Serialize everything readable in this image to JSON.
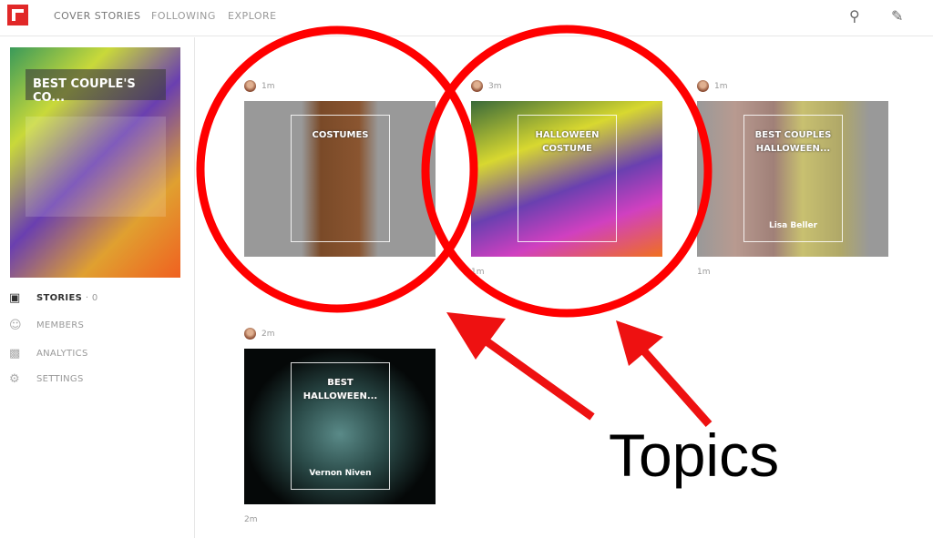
{
  "nav": {
    "items": [
      "COVER STORIES",
      "FOLLOWING",
      "EXPLORE"
    ]
  },
  "icons": {
    "logo": "flipboard-logo",
    "search": "search-icon",
    "edit": "pencil-icon"
  },
  "sidebar": {
    "cover_title": "BEST COUPLE'S CO...",
    "items": [
      {
        "label": "STORIES",
        "count": "· 0",
        "icon": "monitor-icon"
      },
      {
        "label": "MEMBERS",
        "icon": "add-user-icon"
      },
      {
        "label": "ANALYTICS",
        "icon": "bar-chart-icon"
      },
      {
        "label": "SETTINGS",
        "icon": "gear-icon"
      }
    ]
  },
  "cards": [
    {
      "time": "1m",
      "title": "COSTUMES",
      "author": "",
      "below": ""
    },
    {
      "time": "3m",
      "title": "HALLOWEEN COSTUME",
      "author": "",
      "below": "1m"
    },
    {
      "time": "1m",
      "title": "BEST COUPLES HALLOWEEN...",
      "author": "Lisa Beller",
      "below": "1m"
    },
    {
      "time": "2m",
      "title": "BEST HALLOWEEN...",
      "author": "Vernon Niven",
      "below": "2m"
    }
  ],
  "annotation": {
    "label": "Topics",
    "color": "#ff0000"
  }
}
